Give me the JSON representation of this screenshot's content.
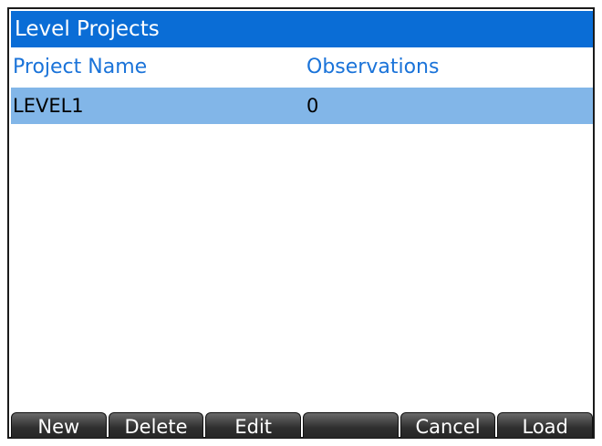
{
  "title": "Level Projects",
  "columns": {
    "name": "Project Name",
    "observations": "Observations"
  },
  "rows": [
    {
      "name": "LEVEL1",
      "observations": "0",
      "selected": true
    }
  ],
  "softkeys": [
    "New",
    "Delete",
    "Edit",
    "",
    "Cancel",
    "Load"
  ],
  "colors": {
    "title_bar": "#0a6dd6",
    "header_text": "#1a73d9",
    "selected_row": "#82b6e8",
    "softkey": "#2e2e2e"
  }
}
